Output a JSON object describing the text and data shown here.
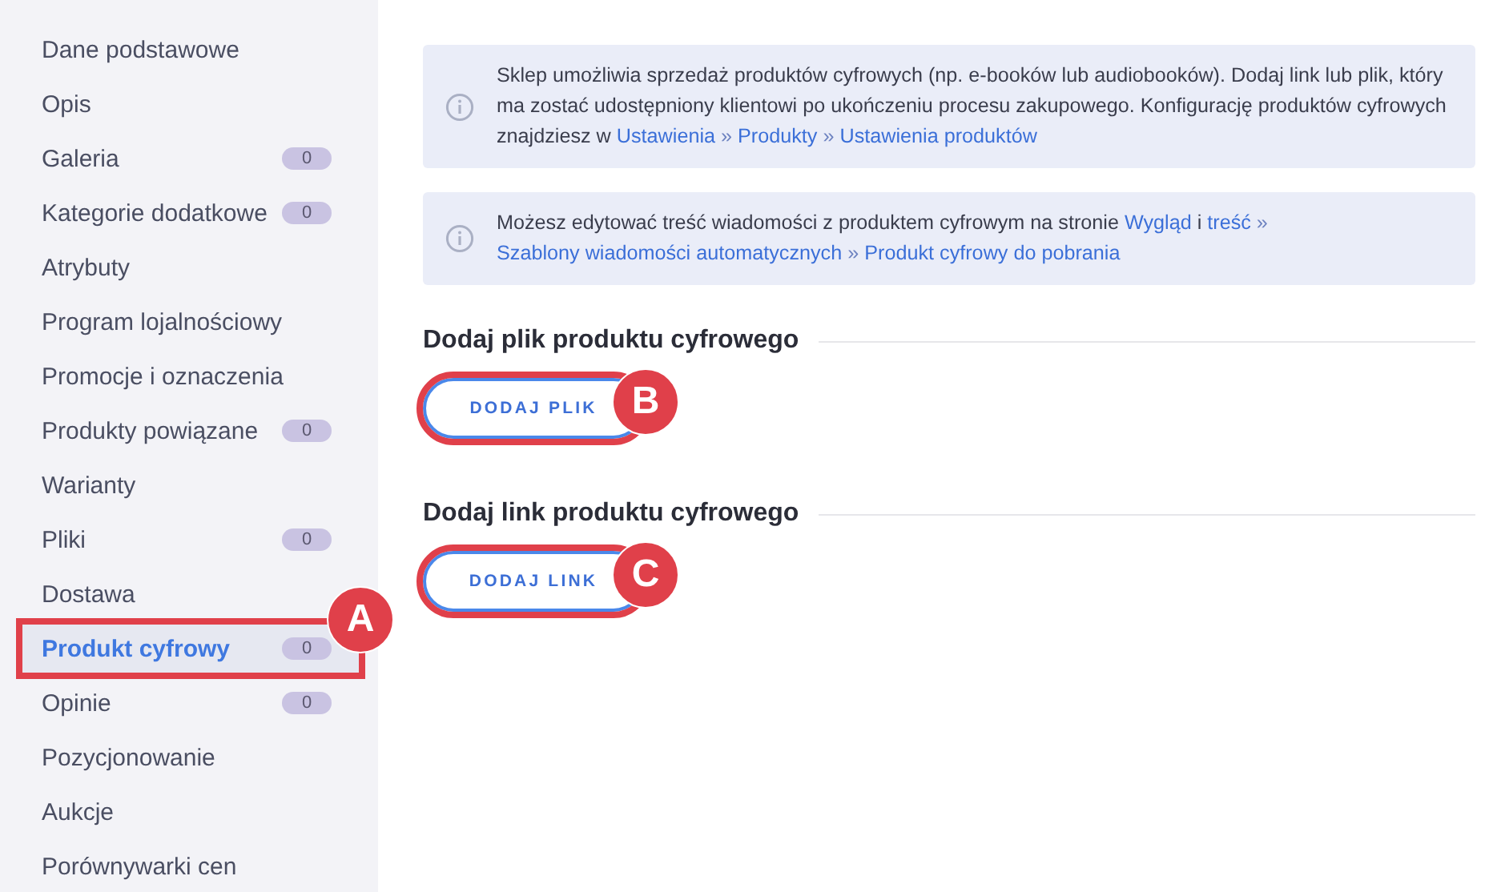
{
  "sidebar": {
    "items": [
      {
        "label": "Dane podstawowe",
        "selected": false
      },
      {
        "label": "Opis",
        "selected": false
      },
      {
        "label": "Galeria",
        "badge": "0",
        "selected": false
      },
      {
        "label": "Kategorie dodatkowe",
        "badge": "0",
        "selected": false
      },
      {
        "label": "Atrybuty",
        "selected": false
      },
      {
        "label": "Program lojalnościowy",
        "selected": false
      },
      {
        "label": "Promocje i oznaczenia",
        "selected": false
      },
      {
        "label": "Produkty powiązane",
        "badge": "0",
        "selected": false
      },
      {
        "label": "Warianty",
        "selected": false
      },
      {
        "label": "Pliki",
        "badge": "0",
        "selected": false
      },
      {
        "label": "Dostawa",
        "selected": false
      },
      {
        "label": "Produkt cyfrowy",
        "badge": "0",
        "selected": true,
        "callout": "A"
      },
      {
        "label": "Opinie",
        "badge": "0",
        "selected": false
      },
      {
        "label": "Pozycjonowanie",
        "selected": false
      },
      {
        "label": "Aukcje",
        "selected": false
      },
      {
        "label": "Porównywarki cen",
        "selected": false
      }
    ]
  },
  "notices": [
    {
      "segments": [
        {
          "kind": "text",
          "text": "Sklep umożliwia sprzedaż produktów cyfrowych (np. e-booków lub audiobooków). Dodaj link lub plik, który ma zostać udostępniony klientowi po ukończeniu procesu zakupowego. Konfigurację produktów cyfrowych znajdziesz w "
        },
        {
          "kind": "link",
          "text": "Ustawienia"
        },
        {
          "kind": "sep",
          "text": " » "
        },
        {
          "kind": "link",
          "text": "Produkty"
        },
        {
          "kind": "sep",
          "text": " » "
        },
        {
          "kind": "link",
          "text": "Ustawienia produktów"
        }
      ]
    },
    {
      "segments": [
        {
          "kind": "text",
          "text": "Możesz edytować treść wiadomości z produktem cyfrowym na stronie "
        },
        {
          "kind": "link",
          "text": "Wygląd"
        },
        {
          "kind": "text",
          "text": " i "
        },
        {
          "kind": "link",
          "text": "treść"
        },
        {
          "kind": "sep",
          "text": " » "
        },
        {
          "kind": "link",
          "text": "Szablony "
        },
        {
          "kind": "link",
          "text": "wiadomości automatycznych"
        },
        {
          "kind": "sep",
          "text": " » "
        },
        {
          "kind": "link",
          "text": "Produkt cyfrowy do pobrania"
        }
      ]
    }
  ],
  "sections": [
    {
      "heading": "Dodaj plik produktu cyfrowego",
      "button": "DODAJ PLIK",
      "callout": "B"
    },
    {
      "heading": "Dodaj link produktu cyfrowego",
      "button": "DODAJ LINK",
      "callout": "C"
    }
  ]
}
